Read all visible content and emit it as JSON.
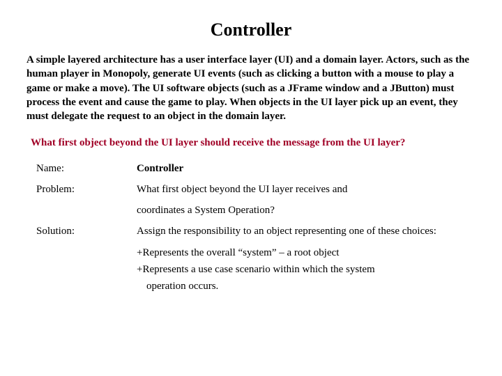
{
  "title": "Controller",
  "paragraph": "A simple layered architecture has a user interface layer (UI) and a domain layer.  Actors, such as the human player in Monopoly, generate UI events (such as clicking a button with a mouse to play a game or make a move).  The UI software objects (such as a JFrame window and a JButton) must process the event and cause the game to play.   When objects in the UI layer pick up an event, they must delegate the request to an object in the domain layer.",
  "question": "What first object beyond the UI layer should receive the message from the UI layer?",
  "rows": {
    "name": {
      "label": "Name:",
      "value": "Controller"
    },
    "problem": {
      "label": "Problem:",
      "value": "What first object beyond the UI layer receives and"
    },
    "problem_cont": "coordinates a System Operation?",
    "solution": {
      "label": "Solution:",
      "value": "Assign the responsibility to an object representing one of these choices:"
    }
  },
  "choices": {
    "c1": "+Represents the overall “system” – a root object",
    "c2a": "+Represents a use case scenario within which the system",
    "c2b": "operation occurs."
  }
}
